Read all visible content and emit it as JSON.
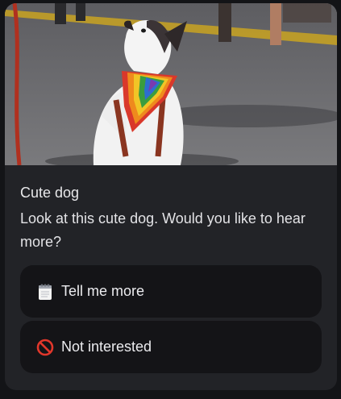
{
  "card": {
    "title": "Cute dog",
    "description": "Look at this cute dog. Would you like to hear more?",
    "image_icon": "dog-photo"
  },
  "actions": [
    {
      "label": "Tell me more",
      "icon": "notepad-icon"
    },
    {
      "label": "Not interested",
      "icon": "no-entry-icon"
    }
  ],
  "colors": {
    "background": "#131417",
    "card": "#222327",
    "chip": "#141417",
    "text": "#e8e8ea"
  }
}
